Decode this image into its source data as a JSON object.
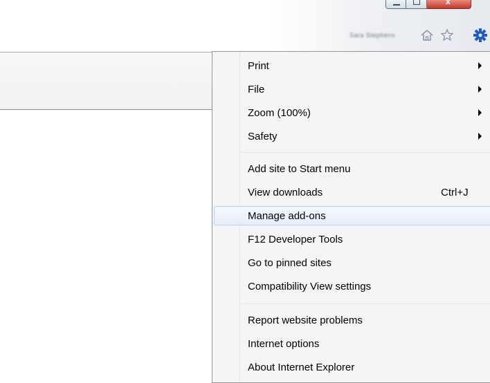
{
  "window": {
    "user_name": "Sara Stephens"
  },
  "toolbar_icons": [
    "home-icon",
    "favorites-star-icon",
    "tools-gear-icon"
  ],
  "colors": {
    "accent": "#1e5bc2",
    "menu_bg": "#f5f5f5",
    "highlight_border": "#aecff7",
    "close_button": "#c7382a"
  },
  "menu": {
    "groups": [
      [
        {
          "label": "Print",
          "submenu": true
        },
        {
          "label": "File",
          "submenu": true
        },
        {
          "label": "Zoom (100%)",
          "submenu": true
        },
        {
          "label": "Safety",
          "submenu": true
        }
      ],
      [
        {
          "label": "Add site to Start menu"
        },
        {
          "label": "View downloads",
          "shortcut": "Ctrl+J"
        },
        {
          "label": "Manage add-ons",
          "highlighted": true
        },
        {
          "label": "F12 Developer Tools"
        },
        {
          "label": "Go to pinned sites"
        },
        {
          "label": "Compatibility View settings"
        }
      ],
      [
        {
          "label": "Report website problems"
        },
        {
          "label": "Internet options"
        },
        {
          "label": "About Internet Explorer"
        }
      ]
    ]
  }
}
